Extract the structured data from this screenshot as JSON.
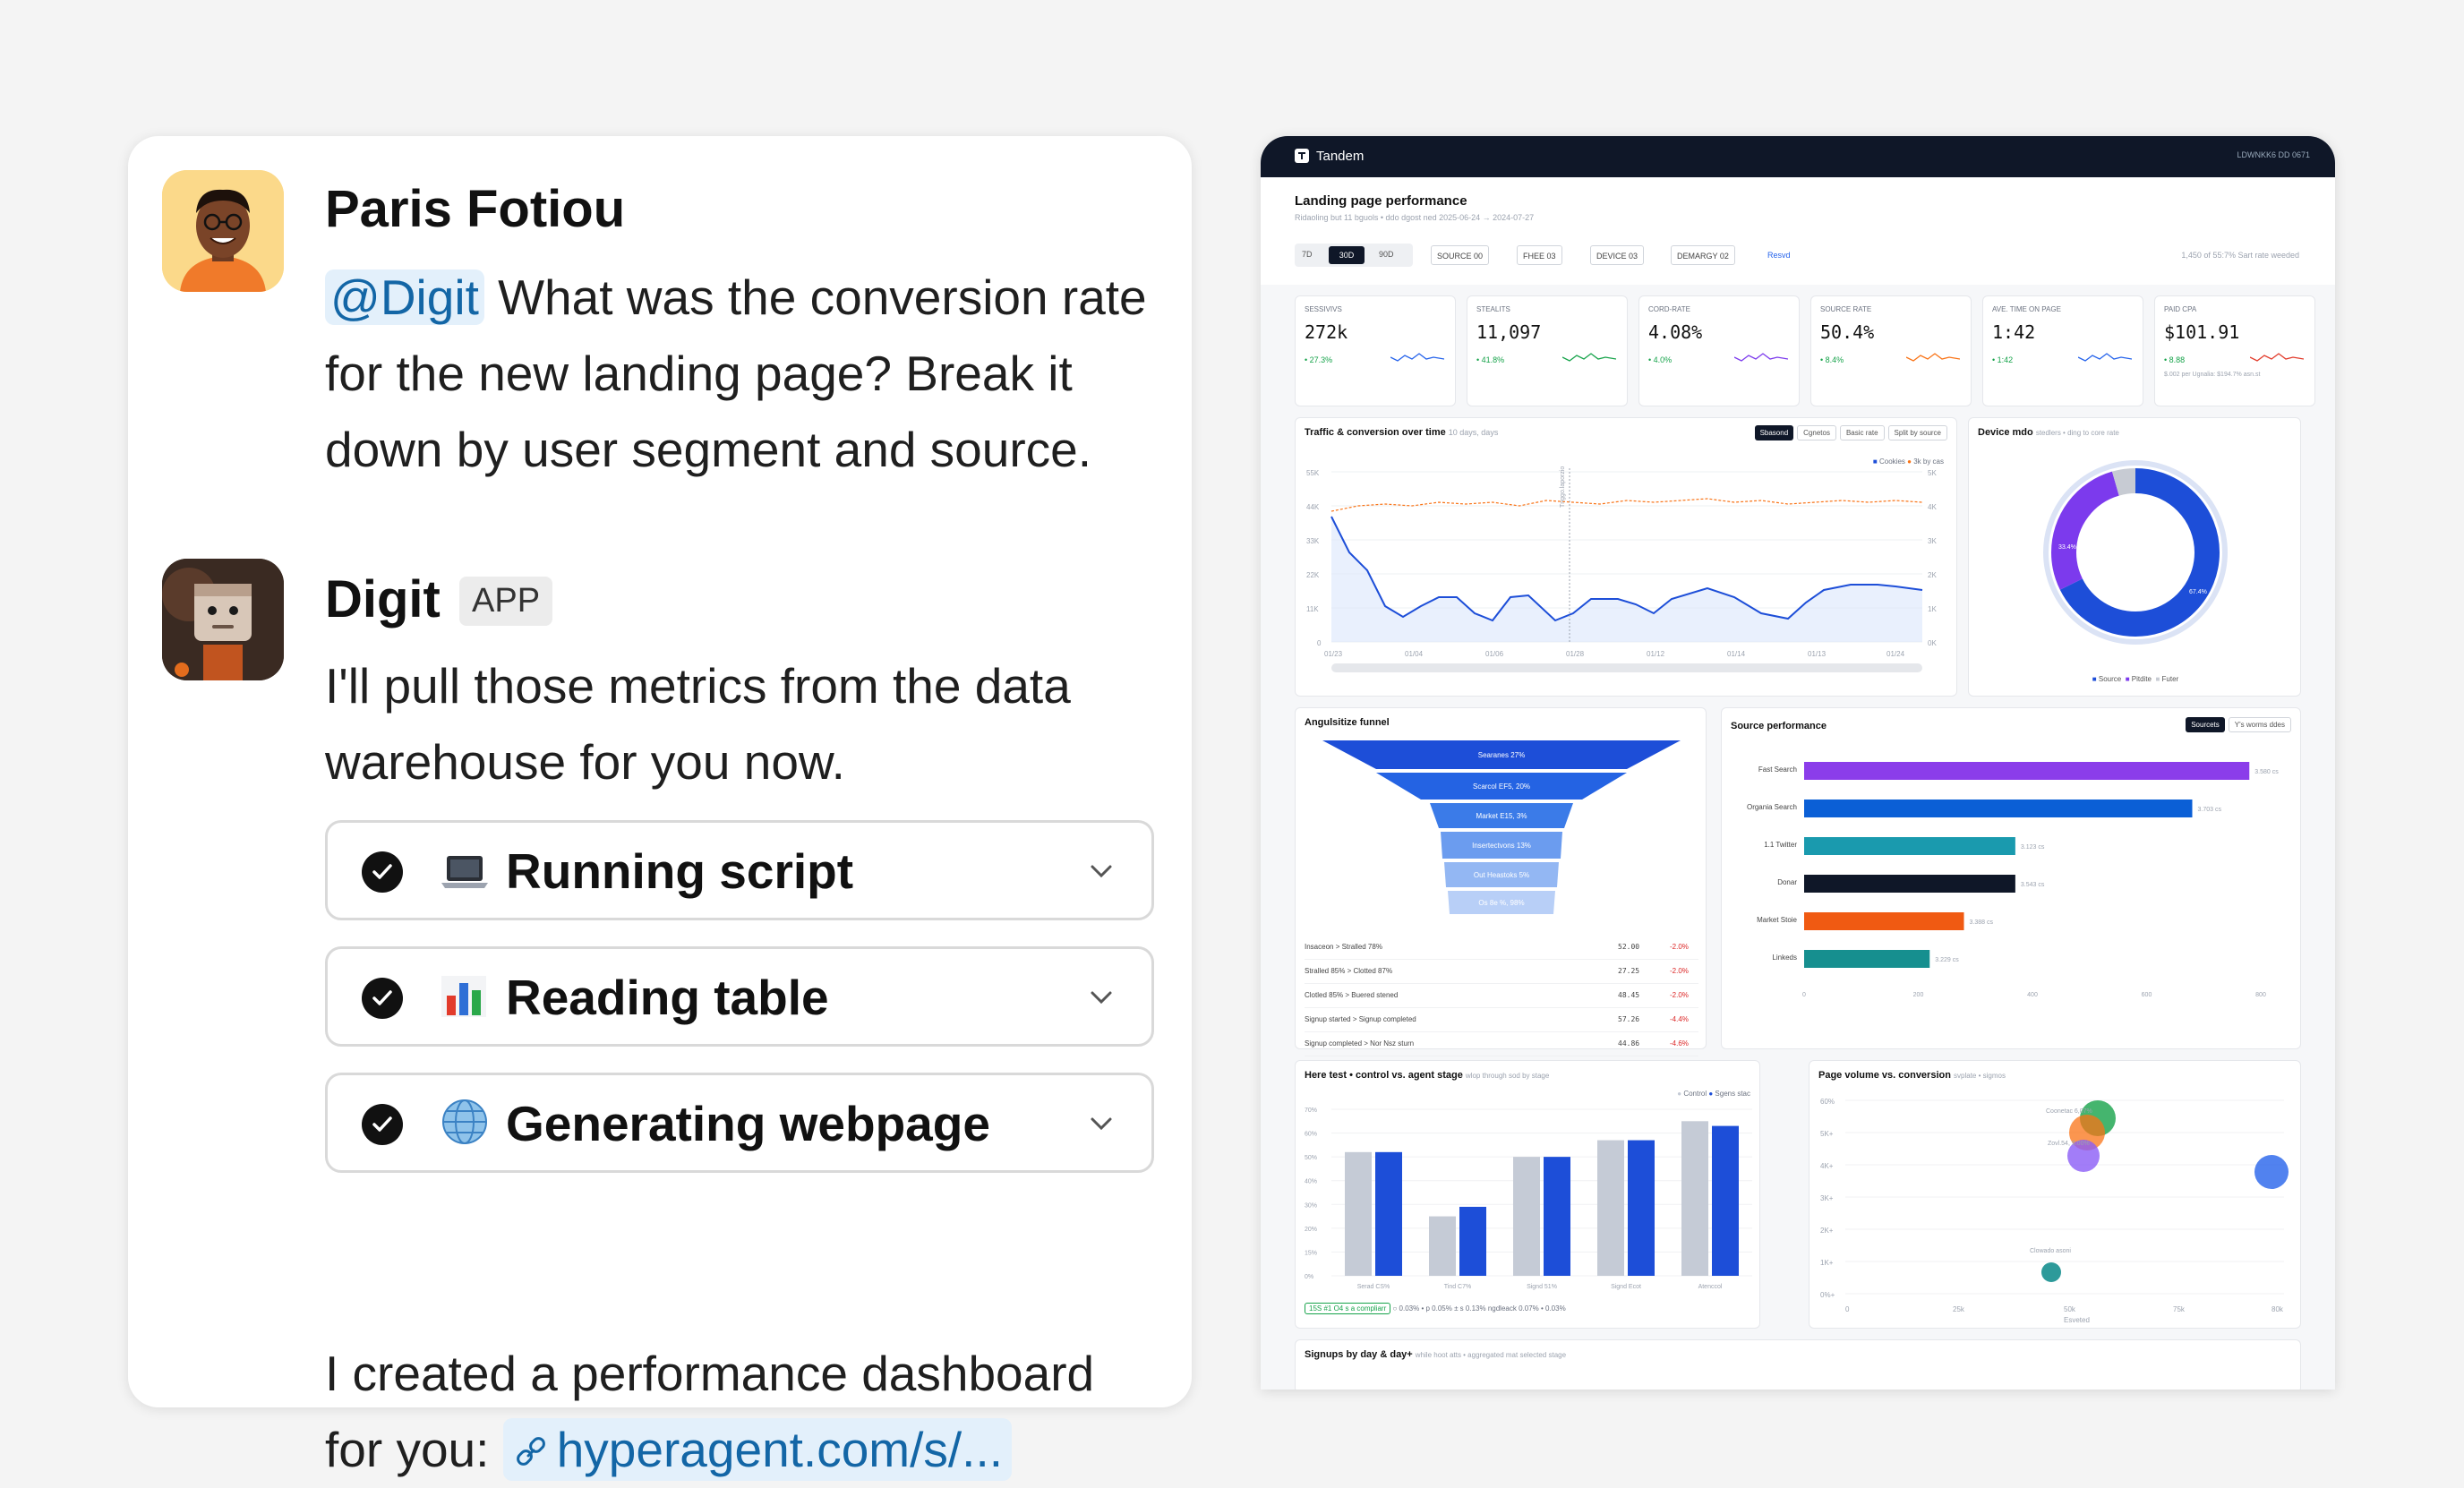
{
  "chat": {
    "user": {
      "name": "Paris Fotiou",
      "mention": "@Digit",
      "message_lines": [
        " What was the conversion rate",
        "for the new landing page? Break it",
        "down by user segment and source."
      ]
    },
    "bot": {
      "name": "Digit",
      "badge": "APP",
      "message_lines": [
        "I'll pull those metrics from the data",
        "warehouse for you now."
      ],
      "tasks": [
        {
          "label": "Running script",
          "icon": "laptop-icon"
        },
        {
          "label": "Reading table",
          "icon": "bar-chart-icon"
        },
        {
          "label": "Generating webpage",
          "icon": "globe-icon"
        }
      ],
      "result_lines": [
        "I created a performance dashboard",
        "for you: "
      ],
      "link": "hyperagent.com/s/..."
    },
    "colors": {
      "mention_bg": "#e3f0fb",
      "mention_text": "#1366a6"
    }
  },
  "dashboard": {
    "brand": "Tandem",
    "status": "LDWNKK6 DD 0671",
    "title": "Landing page performance",
    "subtitle": "Ridaoling but 11 bguols • ddo dgost ned 2025-06-24 → 2024-07-27",
    "range_buttons": [
      "7D",
      "30D",
      "90D"
    ],
    "filters": [
      "SOURCE 00",
      "FHEE 03",
      "DEVICE 03",
      "DEMARGY 02"
    ],
    "filter_link": "Resvd",
    "toolbar_note": "1,450 of 55:7% Sart rate weeded",
    "kpis": [
      {
        "label": "SESSIVIVS",
        "value": "272k",
        "delta": "• 27.3%"
      },
      {
        "label": "STEALITS",
        "value": "11,097",
        "delta": "• 41.8%"
      },
      {
        "label": "CORD-RATE",
        "value": "4.08%",
        "delta": "• 4.0%"
      },
      {
        "label": "SOURCE RATE",
        "value": "50.4%",
        "delta": "• 8.4%"
      },
      {
        "label": "AVE. TIME ON PAGE",
        "value": "1:42",
        "delta": "• 1:42"
      },
      {
        "label": "PAID CPA",
        "value": "$101.91",
        "delta": "• 8.88"
      }
    ],
    "paid_note": "$.002 per Ugnalia: $194.7% asn.st",
    "traffic": {
      "title": "Traffic & conversion over time",
      "hint": "10 days, days",
      "tabs": [
        "Sbasond",
        "Cgnetos",
        "Basic rate",
        "Split by source"
      ],
      "legend": [
        "Cookies",
        "3k by cas"
      ],
      "annotation": "Tnggo.laporzio"
    },
    "device": {
      "title": "Device mdo",
      "hint": "stedlers • ding to core rate",
      "legend": [
        "Source",
        "Pitdite",
        "Futer"
      ],
      "labels": [
        "33.4%",
        "67.4%"
      ]
    },
    "funnel": {
      "title": "Angulsitize funnel",
      "stages": [
        "Searanes 27%",
        "Scarcol EF5, 20%",
        "Market E15, 3%",
        "Insertectvons 13%",
        "Out Heastoks 5%",
        "Os 8e %, 98%"
      ],
      "rows": [
        {
          "label": "Insaceon > Stralled 78%",
          "value": "52.00",
          "delta": "-2.0%"
        },
        {
          "label": "Stralled 85% > Clotted 87%",
          "value": "27.25",
          "delta": "-2.0%"
        },
        {
          "label": "Clotled 85% > Buered stened",
          "value": "48.45",
          "delta": "-2.0%"
        },
        {
          "label": "Signup started > Signup completed",
          "value": "57.26",
          "delta": "-4.4%"
        },
        {
          "label": "Signup completed > Nor Nsz sturn",
          "value": "44.86",
          "delta": "-4.6%"
        }
      ]
    },
    "source_perf": {
      "title": "Source performance",
      "tabs": [
        "Sourcets",
        "Y's worms ddes"
      ],
      "chart_data": {
        "type": "bar",
        "categories": [
          "Fast Search",
          "Organia Search",
          "1.1 Twitter",
          "Donar",
          "Market Stoie",
          "Linkeds"
        ],
        "values": [
          780,
          680,
          370,
          370,
          280,
          220
        ],
        "value_labels": [
          "3.580 cs",
          "3.703 cs",
          "3.123 cs",
          "3.543 cs",
          "3.388 cs",
          "3.229 cs"
        ],
        "colors": [
          "#8b3dea",
          "#0b5fd6",
          "#1a9aae",
          "#0f1728",
          "#f05a12",
          "#168f8f"
        ],
        "xlim": [
          0,
          800
        ],
        "xticks": [
          "0",
          "200",
          "400",
          "600",
          "800"
        ]
      }
    },
    "abtest": {
      "title": "Here test • control vs. agent stage",
      "hint": "wlop through sod by stage",
      "legend": [
        "Control",
        "Sgens stac"
      ],
      "chart_data": {
        "type": "bar",
        "categories": [
          "Serad CS%",
          "Tind C7%",
          "Signd 51%",
          "Signd Ecot",
          "Atenccol"
        ],
        "series": [
          {
            "name": "Control",
            "values": [
              52,
              25,
              50,
              57,
              65
            ]
          },
          {
            "name": "Sgens stac",
            "values": [
              52,
              29,
              50,
              57,
              63
            ]
          }
        ],
        "yticks": [
          "70%",
          "60%",
          "50%",
          "40%",
          "30%",
          "20%",
          "15%",
          "0%"
        ],
        "ylim": [
          0,
          70
        ]
      },
      "footer": [
        "15S #1 O4 s a compliarr",
        "○ 0.03% • p 0.05% ± s 0.13%",
        "ngdleack 0.07% • 0.03%"
      ]
    },
    "volume": {
      "title": "Page volume vs. conversion",
      "hint": "svplate • sigmos",
      "yticks": [
        "60%",
        "5K+",
        "4K+",
        "3K+",
        "2K+",
        "1K+",
        "0%+"
      ],
      "xticks": [
        "0",
        "25k",
        "50k",
        "75k",
        "80k"
      ],
      "xlabel": "Esveted",
      "labels": [
        "Coonetac 6,07%",
        "Zovl.54, 9.00%",
        "Clowado asoni"
      ]
    },
    "signups": {
      "title": "Signups by day & day+",
      "hint": "while hoot atts • aggregated mat selected stage"
    }
  }
}
